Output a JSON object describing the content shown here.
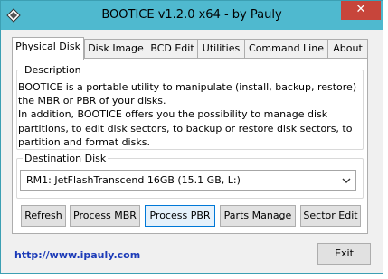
{
  "window": {
    "title": "BOOTICE v1.2.0 x64 - by Pauly",
    "close_glyph": "✕"
  },
  "tabs": [
    {
      "label": "Physical Disk",
      "active": true
    },
    {
      "label": "Disk Image",
      "active": false
    },
    {
      "label": "BCD Edit",
      "active": false
    },
    {
      "label": "Utilities",
      "active": false
    },
    {
      "label": "Command Line",
      "active": false
    },
    {
      "label": "About",
      "active": false
    }
  ],
  "description": {
    "legend": "Description",
    "lines": [
      "BOOTICE is a portable utility to manipulate (install, backup, restore)",
      "the MBR or PBR of your disks.",
      "In addition, BOOTICE offers you the possibility to manage disk",
      "partitions, to edit disk sectors, to backup or restore disk sectors, to",
      "partition and format disks."
    ]
  },
  "destination": {
    "legend": "Destination Disk",
    "selected": "RM1: JetFlashTranscend 16GB (15.1 GB, L:)"
  },
  "buttons": {
    "refresh": "Refresh",
    "process_mbr": "Process MBR",
    "process_pbr": "Process PBR",
    "parts_manage": "Parts Manage",
    "sector_edit": "Sector Edit"
  },
  "footer": {
    "link": "http://www.ipauly.com",
    "exit": "Exit"
  },
  "colors": {
    "titlebar": "#4fb9cf",
    "close": "#c7453b",
    "link": "#1c3bb8"
  },
  "icons": {
    "app": "bootice-app-icon",
    "close": "close-icon",
    "dropdown": "chevron-down-icon"
  }
}
